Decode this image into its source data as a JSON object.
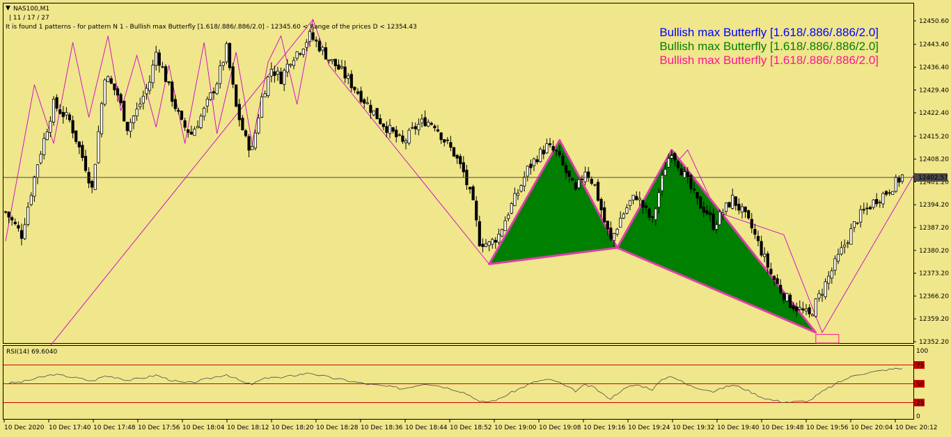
{
  "header": {
    "symbol": "NAS100,M1",
    "subline": "| 11 / 17 / 27",
    "info": "It is found 1 patterns  -  for pattern N 1 - Bullish max Butterfly [1.618/.886/.886/2.0] - 12345.60 < Range of the prices D < 12354.43"
  },
  "legend": [
    {
      "text": "Bullish max Butterfly [1.618/.886/.886/2.0]",
      "color": "#0000ff"
    },
    {
      "text": "Bullish max Butterfly [1.618/.886/.886/2.0]",
      "color": "#008000"
    },
    {
      "text": "Bullish max Butterfly [1.618/.886/.886/2.0]",
      "color": "#ff1493"
    }
  ],
  "price_labels": [
    "12450.60",
    "12443.40",
    "12436.40",
    "12429.40",
    "12422.40",
    "12415.20",
    "12408.20",
    "12401.20",
    "12394.20",
    "12387.20",
    "12380.20",
    "12373.20",
    "12366.20",
    "12359.20",
    "12352.20"
  ],
  "current_price": "12402.57",
  "rsi": {
    "label": "RSI(14) 69.6040",
    "scale_labels": [
      "100",
      "0"
    ],
    "levels": [
      "75",
      "50",
      "25"
    ]
  },
  "time_labels": [
    "10 Dec 2020",
    "10 Dec 17:40",
    "10 Dec 17:48",
    "10 Dec 17:56",
    "10 Dec 18:04",
    "10 Dec 18:12",
    "10 Dec 18:20",
    "10 Dec 18:28",
    "10 Dec 18:36",
    "10 Dec 18:44",
    "10 Dec 18:52",
    "10 Dec 19:00",
    "10 Dec 19:08",
    "10 Dec 19:16",
    "10 Dec 19:24",
    "10 Dec 19:32",
    "10 Dec 19:40",
    "10 Dec 19:48",
    "10 Dec 19:56",
    "10 Dec 20:04",
    "10 Dec 20:12"
  ],
  "chart_data": {
    "type": "candlestick",
    "symbol": "NAS100",
    "timeframe": "M1",
    "price_range": [
      12352.2,
      12450.6
    ],
    "current_price": 12402.57,
    "close_path": [
      [
        0,
        12392
      ],
      [
        5,
        12385
      ],
      [
        10,
        12407
      ],
      [
        15,
        12425
      ],
      [
        20,
        12420
      ],
      [
        25,
        12406
      ],
      [
        27,
        12399
      ],
      [
        31,
        12434
      ],
      [
        35,
        12428
      ],
      [
        38,
        12418
      ],
      [
        41,
        12423
      ],
      [
        45,
        12432
      ],
      [
        47,
        12441
      ],
      [
        49,
        12436
      ],
      [
        52,
        12427
      ],
      [
        55,
        12419
      ],
      [
        58,
        12416
      ],
      [
        62,
        12423
      ],
      [
        66,
        12432
      ],
      [
        69,
        12442
      ],
      [
        72,
        12424
      ],
      [
        75,
        12414
      ],
      [
        77,
        12411
      ],
      [
        80,
        12427
      ],
      [
        83,
        12436
      ],
      [
        86,
        12433
      ],
      [
        89,
        12439
      ],
      [
        92,
        12442
      ],
      [
        95,
        12446
      ],
      [
        97,
        12444
      ],
      [
        101,
        12439
      ],
      [
        105,
        12435
      ],
      [
        109,
        12430
      ],
      [
        113,
        12425
      ],
      [
        117,
        12420
      ],
      [
        121,
        12416
      ],
      [
        124,
        12413
      ],
      [
        128,
        12418
      ],
      [
        131,
        12420
      ],
      [
        134,
        12419
      ],
      [
        137,
        12414
      ],
      [
        140,
        12410
      ],
      [
        143,
        12404
      ],
      [
        146,
        12394
      ],
      [
        148,
        12383
      ],
      [
        151,
        12382
      ],
      [
        154,
        12385
      ],
      [
        157,
        12392
      ],
      [
        160,
        12398
      ],
      [
        163,
        12405
      ],
      [
        166,
        12409
      ],
      [
        169,
        12412
      ],
      [
        172,
        12410
      ],
      [
        175,
        12404
      ],
      [
        178,
        12398
      ],
      [
        181,
        12405
      ],
      [
        184,
        12400
      ],
      [
        187,
        12389
      ],
      [
        189,
        12383
      ],
      [
        192,
        12390
      ],
      [
        195,
        12395
      ],
      [
        197,
        12397
      ],
      [
        200,
        12392
      ],
      [
        202,
        12389
      ],
      [
        204,
        12398
      ],
      [
        206,
        12406
      ],
      [
        208,
        12411
      ],
      [
        210,
        12407
      ],
      [
        213,
        12401
      ],
      [
        216,
        12395
      ],
      [
        219,
        12392
      ],
      [
        221,
        12388
      ],
      [
        224,
        12392
      ],
      [
        227,
        12396
      ],
      [
        230,
        12392
      ],
      [
        233,
        12387
      ],
      [
        236,
        12380
      ],
      [
        239,
        12373
      ],
      [
        242,
        12368
      ],
      [
        245,
        12364
      ],
      [
        248,
        12362
      ],
      [
        251,
        12360
      ],
      [
        254,
        12366
      ],
      [
        257,
        12372
      ],
      [
        260,
        12378
      ],
      [
        263,
        12384
      ],
      [
        266,
        12390
      ],
      [
        269,
        12393
      ],
      [
        272,
        12396
      ],
      [
        275,
        12398
      ],
      [
        278,
        12401
      ],
      [
        280,
        12403
      ]
    ],
    "zigzag_points": [
      [
        0,
        12383
      ],
      [
        9,
        12431
      ],
      [
        15,
        12413
      ],
      [
        21,
        12444
      ],
      [
        26,
        12421
      ],
      [
        32,
        12446
      ],
      [
        36,
        12423
      ],
      [
        41,
        12440
      ],
      [
        47,
        12418
      ],
      [
        51,
        12437
      ],
      [
        56,
        12413
      ],
      [
        62,
        12444
      ],
      [
        66,
        12416
      ],
      [
        72,
        12441
      ],
      [
        77,
        12413
      ],
      [
        82,
        12438
      ],
      [
        86,
        12446
      ],
      [
        91,
        12425
      ],
      [
        96,
        12451
      ],
      [
        101,
        12437
      ],
      [
        151,
        12376
      ],
      [
        173,
        12414
      ],
      [
        191,
        12381
      ],
      [
        202,
        12399
      ],
      [
        213,
        12411
      ],
      [
        222,
        12392
      ],
      [
        243,
        12385
      ],
      [
        255,
        12355
      ],
      [
        284,
        12404
      ]
    ],
    "zigzag_long_line": [
      [
        5,
        12340
      ],
      [
        96,
        12451
      ]
    ],
    "pattern": {
      "name": "Bullish max Butterfly [1.618/.886/.886/2.0]",
      "points": {
        "X": [
          151,
          12376
        ],
        "A": [
          173,
          12414
        ],
        "B": [
          191,
          12381
        ],
        "C": [
          208,
          12411
        ],
        "D": [
          253,
          12355
        ]
      },
      "d_range": [
        12345.6,
        12354.43
      ]
    },
    "rsi": {
      "period": 14,
      "value": 69.604,
      "ylim": [
        0,
        100
      ],
      "levels": [
        75,
        50,
        25
      ],
      "path": [
        [
          0,
          50
        ],
        [
          5,
          52
        ],
        [
          10,
          57
        ],
        [
          15,
          62
        ],
        [
          20,
          59
        ],
        [
          25,
          55
        ],
        [
          27,
          53
        ],
        [
          31,
          60
        ],
        [
          35,
          58
        ],
        [
          38,
          54
        ],
        [
          41,
          56
        ],
        [
          45,
          59
        ],
        [
          47,
          61
        ],
        [
          49,
          58
        ],
        [
          52,
          54
        ],
        [
          55,
          51
        ],
        [
          58,
          51
        ],
        [
          62,
          55
        ],
        [
          66,
          59
        ],
        [
          69,
          62
        ],
        [
          72,
          56
        ],
        [
          75,
          50
        ],
        [
          77,
          49
        ],
        [
          80,
          55
        ],
        [
          83,
          59
        ],
        [
          86,
          57
        ],
        [
          89,
          60
        ],
        [
          92,
          62
        ],
        [
          95,
          64
        ],
        [
          97,
          62
        ],
        [
          101,
          58
        ],
        [
          105,
          55
        ],
        [
          109,
          52
        ],
        [
          113,
          49
        ],
        [
          117,
          47
        ],
        [
          121,
          45
        ],
        [
          124,
          43
        ],
        [
          128,
          47
        ],
        [
          131,
          50
        ],
        [
          134,
          48
        ],
        [
          137,
          45
        ],
        [
          140,
          42
        ],
        [
          143,
          38
        ],
        [
          146,
          32
        ],
        [
          148,
          25
        ],
        [
          151,
          26
        ],
        [
          154,
          29
        ],
        [
          157,
          36
        ],
        [
          160,
          42
        ],
        [
          163,
          48
        ],
        [
          166,
          53
        ],
        [
          169,
          55
        ],
        [
          172,
          53
        ],
        [
          175,
          46
        ],
        [
          178,
          40
        ],
        [
          181,
          48
        ],
        [
          184,
          44
        ],
        [
          187,
          34
        ],
        [
          189,
          30
        ],
        [
          192,
          40
        ],
        [
          195,
          46
        ],
        [
          197,
          48
        ],
        [
          200,
          45
        ],
        [
          202,
          42
        ],
        [
          204,
          51
        ],
        [
          206,
          57
        ],
        [
          208,
          60
        ],
        [
          210,
          55
        ],
        [
          213,
          48
        ],
        [
          216,
          44
        ],
        [
          219,
          42
        ],
        [
          221,
          39
        ],
        [
          224,
          44
        ],
        [
          227,
          48
        ],
        [
          230,
          44
        ],
        [
          233,
          38
        ],
        [
          236,
          32
        ],
        [
          239,
          28
        ],
        [
          242,
          26
        ],
        [
          245,
          25
        ],
        [
          248,
          26
        ],
        [
          251,
          27
        ],
        [
          254,
          36
        ],
        [
          257,
          44
        ],
        [
          260,
          51
        ],
        [
          263,
          57
        ],
        [
          266,
          62
        ],
        [
          269,
          64
        ],
        [
          272,
          66
        ],
        [
          275,
          68
        ],
        [
          278,
          69.6
        ],
        [
          280,
          69.6
        ]
      ]
    }
  }
}
